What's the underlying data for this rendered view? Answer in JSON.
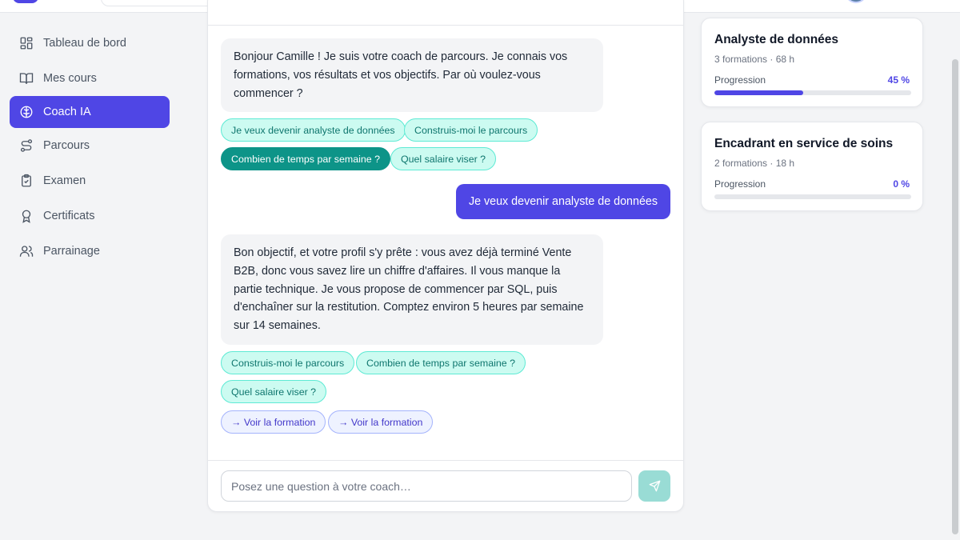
{
  "sidebar": {
    "items": [
      {
        "label": "Tableau de bord",
        "icon": "dashboard-icon"
      },
      {
        "label": "Mes cours",
        "icon": "book-icon"
      },
      {
        "label": "Coach IA",
        "icon": "brain-icon",
        "active": true
      },
      {
        "label": "Parcours",
        "icon": "route-icon"
      },
      {
        "label": "Examen",
        "icon": "clipboard-check-icon"
      },
      {
        "label": "Certificats",
        "icon": "award-icon"
      },
      {
        "label": "Parrainage",
        "icon": "users-icon"
      }
    ]
  },
  "chat": {
    "messages": [
      {
        "role": "coach",
        "text": "Bonjour Camille ! Je suis votre coach de parcours. Je connais vos formations, vos résultats et vos objectifs. Par où voulez-vous commencer ?"
      },
      {
        "role": "user",
        "text": "Je veux devenir analyste de données"
      },
      {
        "role": "coach",
        "text": "Bon objectif, et votre profil s'y prête : vous avez déjà terminé Vente B2B, donc vous savez lire un chiffre d'affaires. Il vous manque la partie technique. Je vous propose de commencer par SQL, puis d'enchaîner sur la restitution. Comptez environ 5 heures par semaine sur 14 semaines."
      }
    ],
    "suggestions_1": [
      "Je veux devenir analyste de données",
      "Construis-moi le parcours",
      "Combien de temps par semaine ?",
      "Quel salaire viser ?"
    ],
    "suggestions_2": [
      "Construis-moi le parcours",
      "Combien de temps par semaine ?",
      "Quel salaire viser ?"
    ],
    "formation_links": [
      "→ Voir la formation",
      "→ Voir la formation"
    ],
    "input_placeholder": "Posez une question à votre coach…",
    "input_value": ""
  },
  "paths": [
    {
      "title": "Analyste de données",
      "meta": "3 formations · 68 h",
      "progress_label": "Progression",
      "progress_text": "45 %",
      "progress": 0.45
    },
    {
      "title": "Encadrant en service de soins",
      "meta": "2 formations · 18 h",
      "progress_label": "Progression",
      "progress_text": "0 %",
      "progress": 0
    }
  ],
  "colors": {
    "accent": "#4f46e5",
    "teal": "#0d9488"
  }
}
